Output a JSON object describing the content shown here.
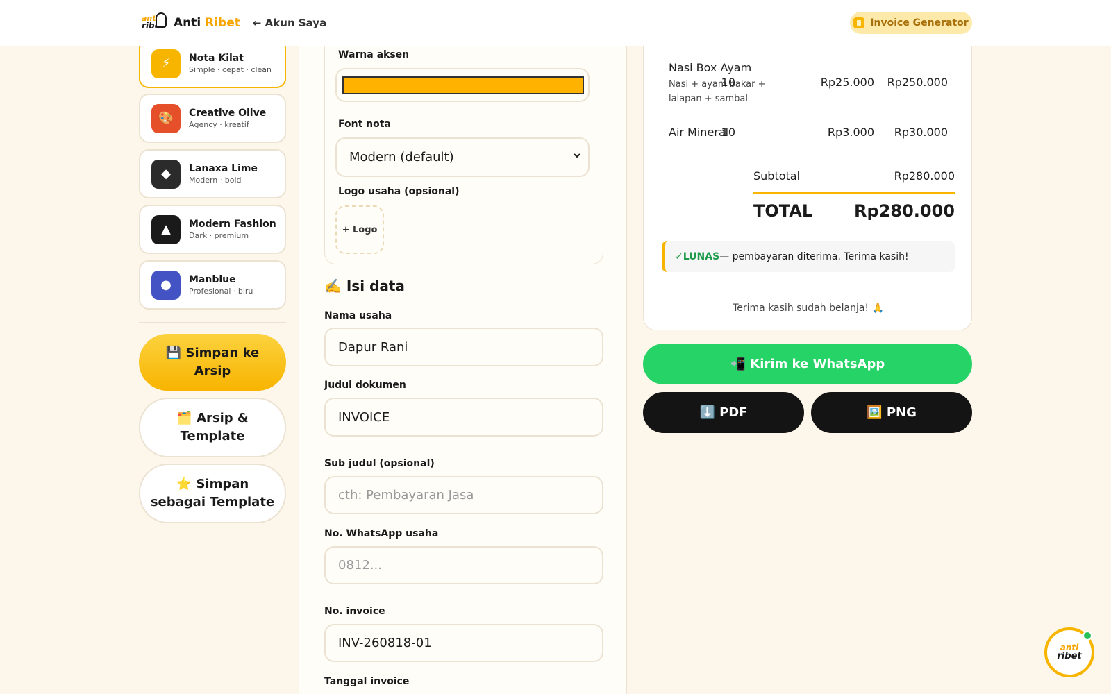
{
  "header": {
    "logo_top": "anti",
    "logo_bottom": "ribet",
    "brand_main": "Anti",
    "brand_accent": "Ribet",
    "back_label": "← Akun Saya",
    "generator_label": "Invoice Generator"
  },
  "templates": [
    {
      "name": "Nota Kilat",
      "sub": "Simple · cepat · clean",
      "icon": "⚡",
      "color": "#f7b500",
      "active": true
    },
    {
      "name": "Creative Olive",
      "sub": "Agency · kreatif",
      "icon": "🎨",
      "color": "#e5502b",
      "active": false
    },
    {
      "name": "Lanaxa Lime",
      "sub": "Modern · bold",
      "icon": "◆",
      "color": "#2b2b2b",
      "active": false
    },
    {
      "name": "Modern Fashion",
      "sub": "Dark · premium",
      "icon": "▲",
      "color": "#1a1a1a",
      "active": false
    },
    {
      "name": "Manblue",
      "sub": "Profesional · biru",
      "icon": "●",
      "color": "#4453c4",
      "active": false
    }
  ],
  "side_buttons": {
    "save_archive": "💾 Simpan ke Arsip",
    "archive_template": "🗂️ Arsip & Template",
    "save_template": "⭐ Simpan sebagai Template"
  },
  "form": {
    "accent_label": "Warna aksen",
    "accent_color": "#ffb300",
    "font_label": "Font nota",
    "font_value": "Modern (default)",
    "logo_label": "Logo usaha (opsional)",
    "logo_button": "+ Logo",
    "section_title": "✍️ Isi data",
    "business_name_label": "Nama usaha",
    "business_name_value": "Dapur Rani",
    "doc_title_label": "Judul dokumen",
    "doc_title_value": "INVOICE",
    "subtitle_label": "Sub judul (opsional)",
    "subtitle_placeholder": "cth: Pembayaran Jasa",
    "wa_label": "No. WhatsApp usaha",
    "wa_placeholder": "0812...",
    "invoice_no_label": "No. invoice",
    "invoice_no_value": "INV-260818-01",
    "invoice_date_label": "Tanggal invoice"
  },
  "invoice": {
    "items": [
      {
        "name": "Nasi Box Ayam",
        "desc": "Nasi + ayam bakar + lalapan + sambal",
        "qty": "10",
        "price": "Rp25.000",
        "total": "Rp250.000"
      },
      {
        "name": "Air Mineral",
        "desc": "",
        "qty": "10",
        "price": "Rp3.000",
        "total": "Rp30.000"
      }
    ],
    "subtotal_label": "Subtotal",
    "subtotal_value": "Rp280.000",
    "total_label": "TOTAL",
    "total_value": "Rp280.000",
    "paid_status": "✓LUNAS",
    "paid_text": " — pembayaran diterima. Terima kasih!",
    "thanks": "Terima kasih sudah belanja! 🙏"
  },
  "actions": {
    "whatsapp": "📲 Kirim ke WhatsApp",
    "pdf": "⬇️ PDF",
    "png": "🖼️ PNG"
  },
  "bot": {
    "top": "anti",
    "bottom": "ribet"
  }
}
